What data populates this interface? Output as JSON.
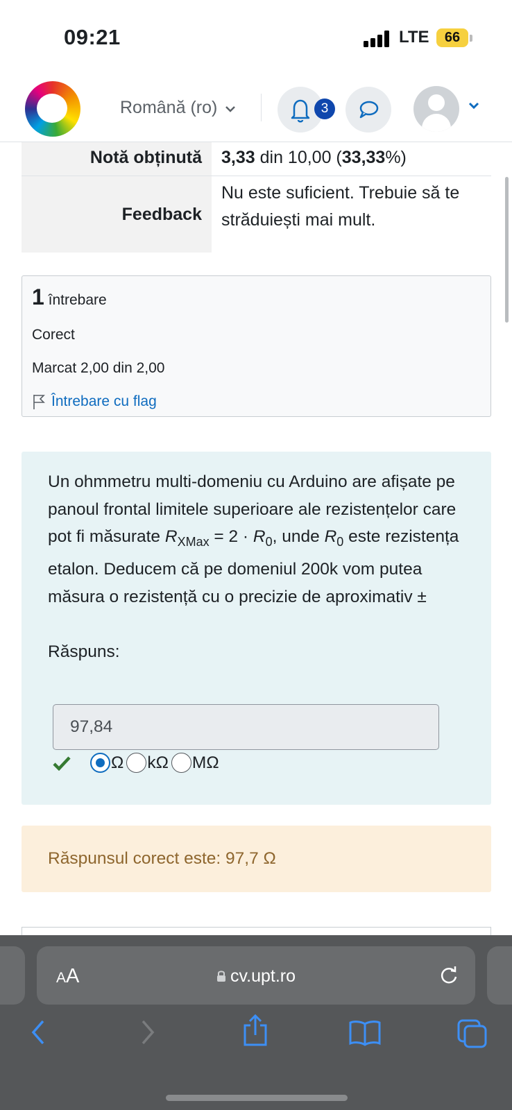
{
  "status": {
    "time": "09:21",
    "network": "LTE",
    "battery": "66"
  },
  "nav": {
    "language": "Română (ro)",
    "notifications_count": "3"
  },
  "summary": {
    "grade_label": "Notă obținută",
    "grade_value_score": "3,33",
    "grade_value_mid": " din 10,00 (",
    "grade_value_pct": "33,33",
    "grade_value_end": "%)",
    "feedback_label": "Feedback",
    "feedback_value": "Nu este suficient. Trebuie să te străduiești mai mult."
  },
  "question": {
    "number": "1",
    "number_label": "întrebare",
    "status": "Corect",
    "mark": "Marcat 2,00 din 2,00",
    "flag_label": "Întrebare cu flag",
    "text_part1": "Un ohmmetru multi-domeniu cu Arduino are afișate pe panoul frontal limitele superioare ale rezistențelor care pot fi măsurate ",
    "r_symbol": "R",
    "r_sub": "XMax",
    "text_part2": " = 2 · ",
    "r0_sub": "0",
    "text_part3": ", unde ",
    "text_part4": " este rezistența etalon. Deducem că pe domeniul 200k vom putea măsura o rezistență cu o precizie de aproximativ ±",
    "answer_label": "Răspuns:",
    "answer_value": "97,84",
    "units": [
      "Ω",
      "kΩ",
      "MΩ"
    ],
    "selected_unit": "Ω",
    "correct_answer": "Răspunsul corect este: 97,7 Ω"
  },
  "browser": {
    "aa_label": "AA",
    "url": "cv.upt.ro"
  },
  "colors": {
    "accent": "#0f6cbf",
    "correct_green": "#357a32",
    "feedback_bg": "#fcefdc",
    "feedback_text": "#8e662e",
    "question_bg": "#e7f3f5"
  }
}
